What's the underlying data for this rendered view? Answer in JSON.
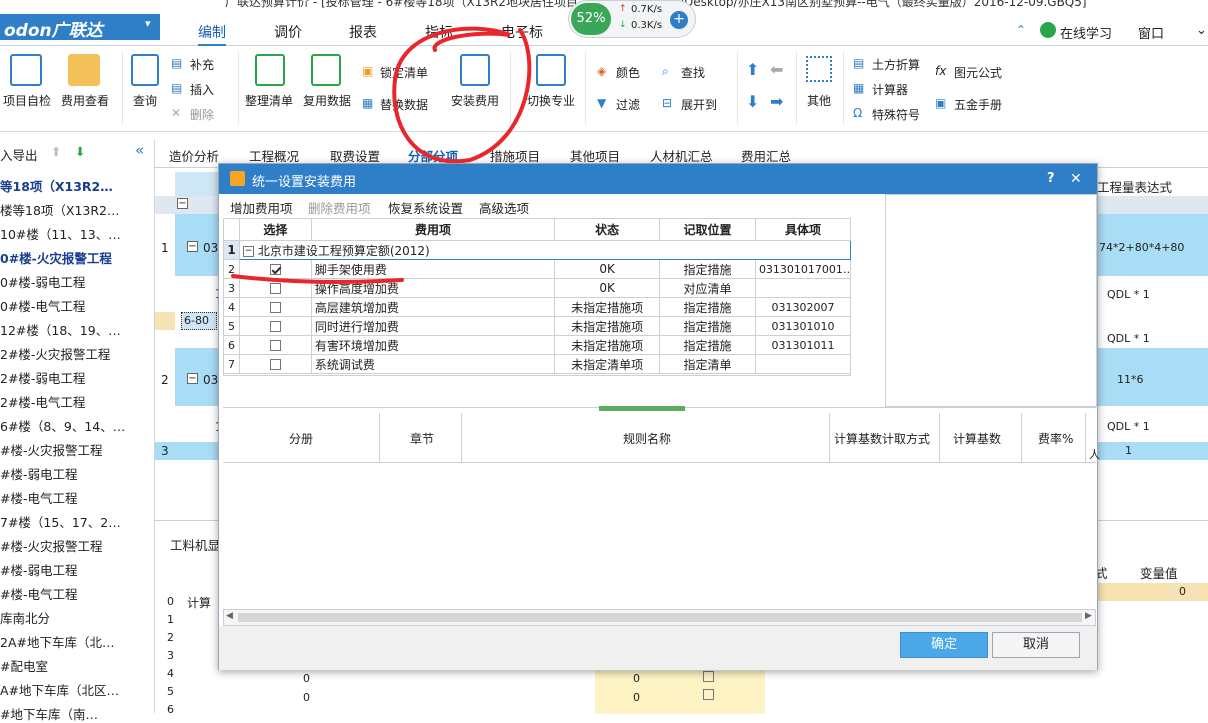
{
  "window_title": "广联达预算计价 - [投标管理 - 6#楼等18项（X13R2地块居住项目",
  "window_title_right": "/Desktop/亦庄X13南区别墅预算--电气（最终实量版）2016-12-09.GBQ5]",
  "perf": {
    "percent": "52%",
    "up": "0.7K/s",
    "down": "0.3K/s"
  },
  "app_brand": "odon广联达",
  "menu_tabs": [
    "编制",
    "调价",
    "报表",
    "指标",
    "电子标"
  ],
  "menu_right": {
    "learn": "在线学习",
    "window": "窗口"
  },
  "ribbon": {
    "self_check": "项目自检",
    "fee_view": "费用查看",
    "query": "查询",
    "supplement": "补充",
    "insert": "插入",
    "delete": "删除",
    "organize": "整理清单",
    "reuse": "复用数据",
    "lock": "锁定清单",
    "replace": "替换数据",
    "install_fee": "安装费用",
    "switch_major": "切换专业",
    "color": "颜色",
    "filter": "过滤",
    "find": "查找",
    "expand": "展开到",
    "other": "其他",
    "earth": "土方折算",
    "calculator": "计算器",
    "special_symbol": "特殊符号",
    "formula": "图元公式",
    "hardware": "五金手册"
  },
  "sidebar": {
    "toolbar": "入导出",
    "items": [
      {
        "label": "等18项（X13R2…",
        "bold": true
      },
      {
        "label": "楼等18项（X13R2…",
        "bold": false
      },
      {
        "label": "10#楼（11、13、…",
        "bold": false
      },
      {
        "label": "0#楼-火灾报警工程",
        "bold": true
      },
      {
        "label": "0#楼-弱电工程",
        "bold": false
      },
      {
        "label": "0#楼-电气工程",
        "bold": false
      },
      {
        "label": "12#楼（18、19、…",
        "bold": false
      },
      {
        "label": "2#楼-火灾报警工程",
        "bold": false
      },
      {
        "label": "2#楼-弱电工程",
        "bold": false
      },
      {
        "label": "2#楼-电气工程",
        "bold": false
      },
      {
        "label": "6#楼（8、9、14、…",
        "bold": false
      },
      {
        "label": "#楼-火灾报警工程",
        "bold": false
      },
      {
        "label": "#楼-弱电工程",
        "bold": false
      },
      {
        "label": "#楼-电气工程",
        "bold": false
      },
      {
        "label": "7#楼（15、17、2…",
        "bold": false
      },
      {
        "label": "#楼-火灾报警工程",
        "bold": false
      },
      {
        "label": "#楼-弱电工程",
        "bold": false
      },
      {
        "label": "#楼-电气工程",
        "bold": false
      },
      {
        "label": "库南北分",
        "bold": false
      },
      {
        "label": "2A#地下车库（北…",
        "bold": false
      },
      {
        "label": "#配电室",
        "bold": false
      },
      {
        "label": "A#地下车库（北区…",
        "bold": false
      },
      {
        "label": "#地下车库（南…",
        "bold": false
      }
    ]
  },
  "sub_tabs": [
    "造价分析",
    "工程概况",
    "取费设置",
    "分部分项",
    "措施项目",
    "其他项目",
    "人材机汇总",
    "费用汇总"
  ],
  "bg_grid": {
    "header_right": "工程量表达式",
    "rows": [
      {
        "num": "1",
        "code": "030",
        "expr": "74*2+80*4+80"
      },
      {
        "num": "",
        "code": "1",
        "expr": "QDL * 1"
      },
      {
        "num": "",
        "code": "6-80",
        "expr": ""
      },
      {
        "num": "",
        "code": "",
        "expr": "QDL * 1"
      },
      {
        "num": "2",
        "code": "030",
        "expr": "11*6"
      },
      {
        "num": "",
        "code": "1",
        "expr": "QDL * 1"
      },
      {
        "num": "3",
        "code": "",
        "expr": "1"
      }
    ],
    "bottom_tab": "工料机显",
    "bottom_col": "计算",
    "right_col1": "式",
    "right_col2": "变量值",
    "right_val": "0",
    "bottom_rows": [
      "0",
      "1",
      "2",
      "3",
      "4",
      "5",
      "6"
    ],
    "bottom_vals": [
      "0",
      "0",
      "0"
    ]
  },
  "dialog": {
    "title": "统一设置安装费用",
    "help": "?",
    "close": "✕",
    "toolbar": [
      "增加费用项",
      "删除费用项",
      "恢复系统设置",
      "高级选项"
    ],
    "columns": [
      "选择",
      "费用项",
      "状态",
      "记取位置",
      "具体项"
    ],
    "group_row": {
      "num": "1",
      "label": "北京市建设工程预算定额(2012)"
    },
    "rows": [
      {
        "num": "2",
        "checked": true,
        "item": "脚手架使用费",
        "status": "0K",
        "position": "指定措施",
        "detail": "031301017001…"
      },
      {
        "num": "3",
        "checked": false,
        "item": "操作高度增加费",
        "status": "0K",
        "position": "对应清单",
        "detail": ""
      },
      {
        "num": "4",
        "checked": false,
        "item": "高层建筑增加费",
        "status": "未指定措施项",
        "position": "指定措施",
        "detail": "031302007"
      },
      {
        "num": "5",
        "checked": false,
        "item": "同时进行增加费",
        "status": "未指定措施项",
        "position": "指定措施",
        "detail": "031301010"
      },
      {
        "num": "6",
        "checked": false,
        "item": "有害环境增加费",
        "status": "未指定措施项",
        "position": "指定措施",
        "detail": "031301011"
      },
      {
        "num": "7",
        "checked": false,
        "item": "系统调试费",
        "status": "未指定清单项",
        "position": "指定清单",
        "detail": ""
      }
    ],
    "lower_columns": [
      "分册",
      "章节",
      "规则名称",
      "计算基数计取方式",
      "计算基数",
      "费率%",
      "人"
    ],
    "ok": "确定",
    "cancel": "取消"
  },
  "colors": {
    "accent": "#2f7fc8",
    "annotation": "#e8262b",
    "selection": "#a9dcf5"
  }
}
